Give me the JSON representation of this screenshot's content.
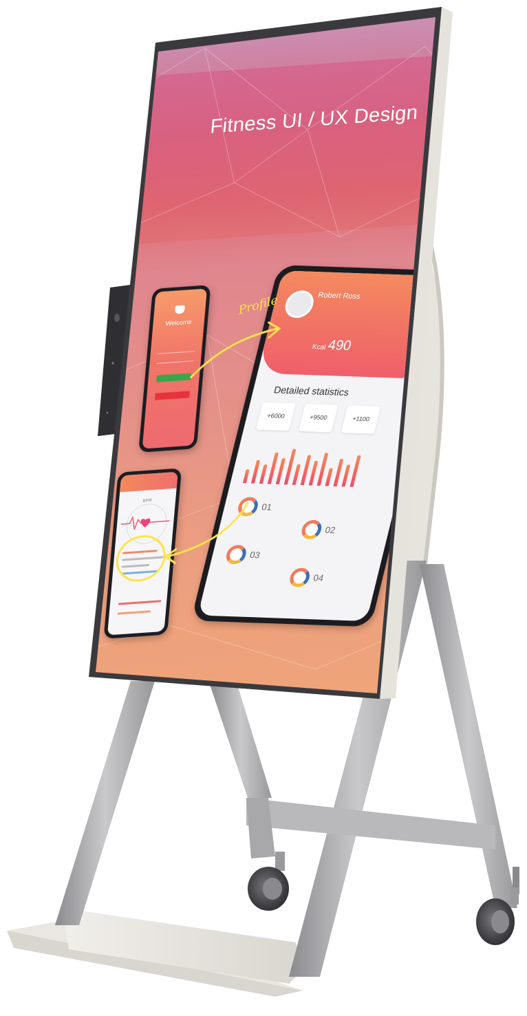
{
  "screen": {
    "title": "Fitness UI / UX Design",
    "body_text": "",
    "annotation": "Profile"
  },
  "phone_welcome": {
    "title": "Welcome"
  },
  "phone_heart": {
    "bpm_label": "BPM"
  },
  "phone_profile": {
    "name": "Robert Ross",
    "kcal_label": "Kcal",
    "kcal_value": "490",
    "section_title": "Detailed statistics",
    "cards": [
      "+6000",
      "+9500",
      "+1100"
    ],
    "ring_numbers": [
      "01",
      "02",
      "03",
      "04"
    ]
  },
  "colors": {
    "screen_top": "#c894b8",
    "screen_mid": "#de6a74",
    "screen_bottom": "#efa479",
    "frame": "#3a3a3e",
    "stand": "#a9a9ab",
    "annotation": "#ffe34a",
    "login_button": "#3aa64a",
    "signup_button": "#e8323a"
  }
}
